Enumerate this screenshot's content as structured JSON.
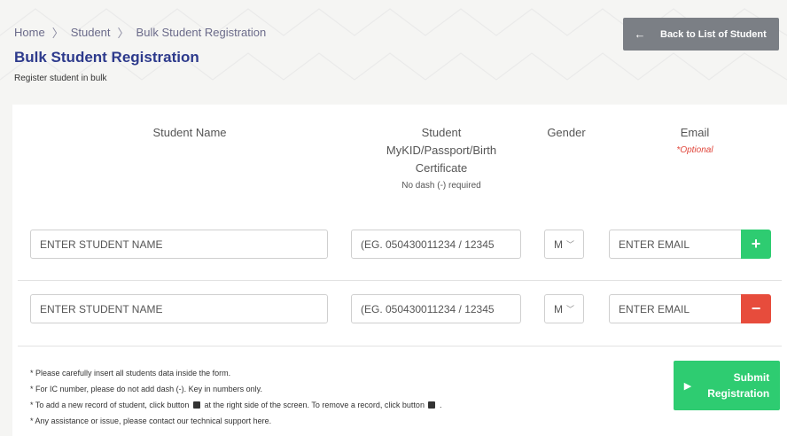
{
  "breadcrumb": [
    "Home",
    "Student",
    "Bulk Student Registration"
  ],
  "title": "Bulk Student Registration",
  "subtitle": "Register student in bulk",
  "back_button": "Back to List of Student",
  "columns": {
    "name": "Student Name",
    "id_line1": "Student",
    "id_line2": "MyKID/Passport/Birth",
    "id_line3": "Certificate",
    "id_note": "No dash (-) required",
    "gender": "Gender",
    "email": "Email",
    "email_note": "*Optional"
  },
  "rows": [
    {
      "name_placeholder": "ENTER STUDENT NAME",
      "id_placeholder": "(EG. 050430011234 / 12345",
      "gender": "M",
      "email_placeholder": "ENTER EMAIL",
      "action": "+"
    },
    {
      "name_placeholder": "ENTER STUDENT NAME",
      "id_placeholder": "(EG. 050430011234 / 12345",
      "gender": "M",
      "email_placeholder": "ENTER EMAIL",
      "action": "−"
    }
  ],
  "notes": {
    "n1": "* Please carefully insert all students data inside the form.",
    "n2": "* For IC number, please do not add dash (-). Key in numbers only.",
    "n3a": "* To add a new record of student, click button",
    "n3b": "at the right side of the screen. To remove a record, click button",
    "n3c": ".",
    "n4": "* Any assistance or issue, please contact our technical support here."
  },
  "submit": {
    "line1": "Submit",
    "line2": "Registration"
  },
  "colors": {
    "accent": "#2d3a8c",
    "add": "#2ecc71",
    "remove": "#e74c3c",
    "back": "#7b7f85",
    "optional": "#e0453a"
  }
}
